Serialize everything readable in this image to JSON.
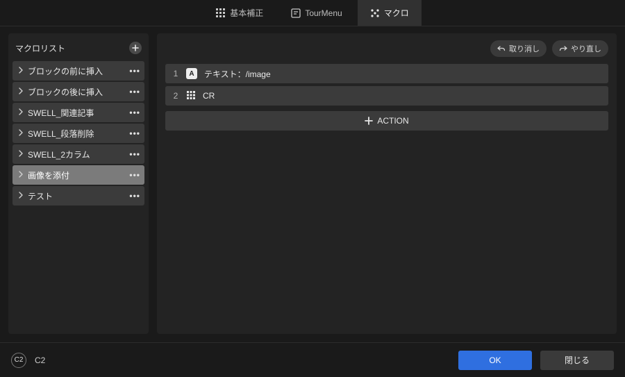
{
  "tabs": {
    "basic": "基本補正",
    "tour": "TourMenu",
    "macro": "マクロ"
  },
  "sidebar": {
    "title": "マクロリスト",
    "items": [
      {
        "label": "ブロックの前に挿入"
      },
      {
        "label": "ブロックの後に挿入"
      },
      {
        "label": "SWELL_関連記事"
      },
      {
        "label": "SWELL_段落削除"
      },
      {
        "label": "SWELL_2カラム"
      },
      {
        "label": "画像を添付"
      },
      {
        "label": "テスト"
      }
    ],
    "selected_index": 5
  },
  "toolbar": {
    "undo": "取り消し",
    "redo": "やり直し"
  },
  "steps": [
    {
      "num": "1",
      "icon": "A",
      "label": "テキスト：/image"
    },
    {
      "num": "2",
      "icon": "grid",
      "label": "CR"
    }
  ],
  "add_action": "ACTION",
  "footer": {
    "badge": "C2",
    "label": "C2",
    "ok": "OK",
    "close": "閉じる"
  }
}
